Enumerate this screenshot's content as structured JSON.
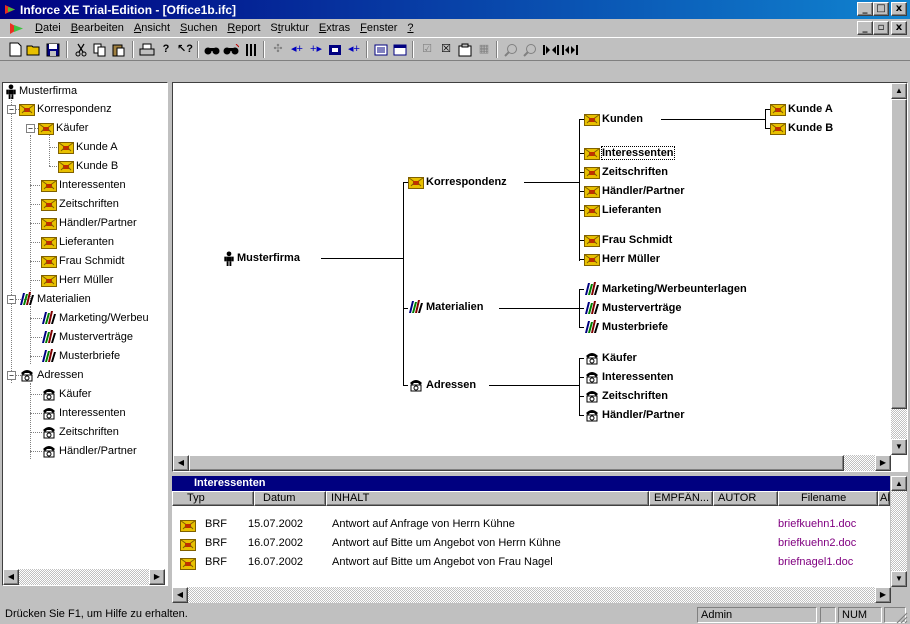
{
  "window": {
    "title": "Inforce XE Trial-Edition - [Office1b.ifc]",
    "controls": {
      "minimize": "_",
      "maximize": "□",
      "close": "x",
      "restore": "▫"
    }
  },
  "menu": {
    "items": [
      {
        "pre": "",
        "key": "D",
        "post": "atei"
      },
      {
        "pre": "",
        "key": "B",
        "post": "earbeiten"
      },
      {
        "pre": "",
        "key": "A",
        "post": "nsicht"
      },
      {
        "pre": "",
        "key": "S",
        "post": "uchen"
      },
      {
        "pre": "",
        "key": "R",
        "post": "eport"
      },
      {
        "pre": "S",
        "key": "t",
        "post": "ruktur"
      },
      {
        "pre": "",
        "key": "E",
        "post": "xtras"
      },
      {
        "pre": "",
        "key": "F",
        "post": "enster"
      },
      {
        "pre": "",
        "key": "?",
        "post": ""
      }
    ]
  },
  "tree": {
    "root": "Musterfirma",
    "korrespondenz": "Korrespondenz",
    "kaeufer": "Käufer",
    "kunde_a": "Kunde A",
    "kunde_b": "Kunde B",
    "interessenten": "Interessenten",
    "zeitschriften": "Zeitschriften",
    "haendler": "Händler/Partner",
    "lieferanten": "Lieferanten",
    "frau_schmidt": "Frau Schmidt",
    "herr_mueller": "Herr Müller",
    "materialien": "Materialien",
    "marketing": "Marketing/Werbeu",
    "mustervertraege": "Musterverträge",
    "musterbriefe": "Musterbriefe",
    "adressen": "Adressen",
    "a_kaeufer": "Käufer",
    "a_interessenten": "Interessenten",
    "a_zeitschriften": "Zeitschriften",
    "a_haendler": "Händler/Partner",
    "expand_minus": "−"
  },
  "chart": {
    "musterfirma": "Musterfirma",
    "korrespondenz": "Korrespondenz",
    "materialien": "Materialien",
    "adressen": "Adressen",
    "kunden": "Kunden",
    "kunde_a": "Kunde A",
    "kunde_b": "Kunde B",
    "interessenten": "Interessenten",
    "zeitschriften": "Zeitschriften",
    "haendler": "Händler/Partner",
    "lieferanten": "Lieferanten",
    "frau_schmidt": "Frau Schmidt",
    "herr_mueller": "Herr Müller",
    "marketing": "Marketing/Werbeunterlagen",
    "mustervertraege": "Musterverträge",
    "musterbriefe": "Musterbriefe",
    "a_kaeufer": "Käufer",
    "a_interessenten": "Interessenten",
    "a_zeitschriften": "Zeitschriften",
    "a_haendler": "Händler/Partner"
  },
  "list": {
    "header": "Interessenten",
    "columns": {
      "typ": "Typ",
      "datum": "Datum",
      "inhalt": "INHALT",
      "empf": "EMPFÄN...",
      "autor": "AUTOR",
      "filename": "Filename",
      "ae": "AE"
    },
    "rows": [
      {
        "typ": "BRF",
        "datum": "15.07.2002",
        "inhalt": "Antwort auf Anfrage von Herrn Kühne",
        "filename": "briefkuehn1.doc"
      },
      {
        "typ": "BRF",
        "datum": "16.07.2002",
        "inhalt": "Antwort auf Bitte um Angebot von Herrn Kühne",
        "filename": "briefkuehn2.doc"
      },
      {
        "typ": "BRF",
        "datum": "16.07.2002",
        "inhalt": "Antwort auf Bitte um Angebot von Frau Nagel",
        "filename": "briefnagel1.doc"
      }
    ]
  },
  "status": {
    "help": "Drücken Sie F1, um Hilfe zu erhalten.",
    "user": "Admin",
    "num": "NUM"
  },
  "colors": {
    "title_start": "#000080",
    "title_end": "#1084d0",
    "folder": "#e8c000",
    "link": "#800080"
  }
}
